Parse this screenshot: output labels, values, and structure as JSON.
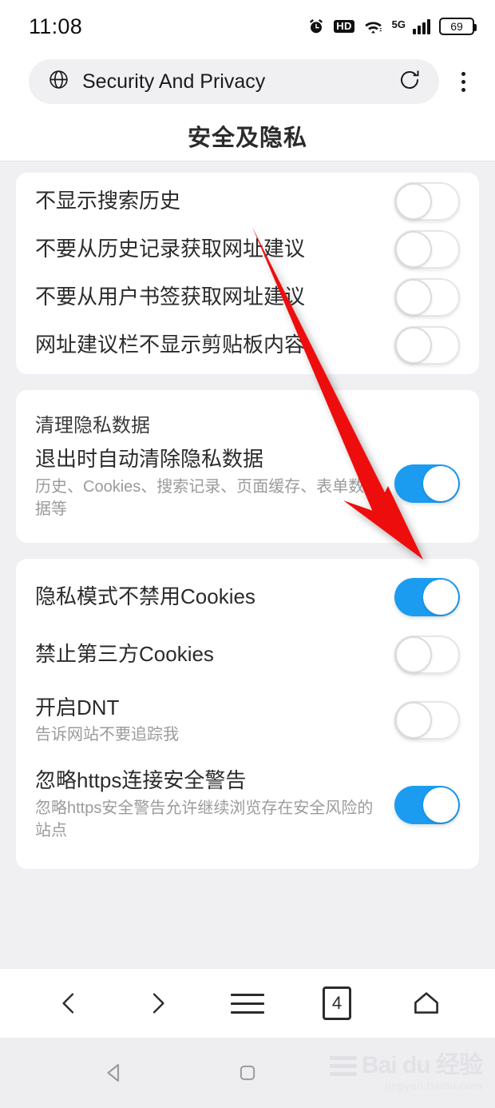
{
  "status_bar": {
    "time": "11:08",
    "alarm_icon": "alarm-clock-icon",
    "hd_label": "HD",
    "wifi_icon": "wifi-icon",
    "network_label": "5G",
    "battery_level": "69"
  },
  "address_bar": {
    "site_icon": "globe-icon",
    "title": "Security And Privacy",
    "reload_icon": "refresh-icon",
    "menu_icon": "more-vertical-icon"
  },
  "page": {
    "title": "安全及隐私"
  },
  "cards": [
    {
      "name": "search-suggestion-card",
      "header": null,
      "rows": [
        {
          "title": "不显示搜索历史",
          "sub": null,
          "state": "off"
        },
        {
          "title": "不要从历史记录获取网址建议",
          "sub": null,
          "state": "off"
        },
        {
          "title": "不要从用户书签获取网址建议",
          "sub": null,
          "state": "off"
        },
        {
          "title": "网址建议栏不显示剪贴板内容",
          "sub": null,
          "state": "off"
        }
      ]
    },
    {
      "name": "clear-private-data-card",
      "header": "清理隐私数据",
      "rows": [
        {
          "title": "退出时自动清除隐私数据",
          "sub": "历史、Cookies、搜索记录、页面缓存、表单数据等",
          "state": "on"
        }
      ]
    },
    {
      "name": "cookies-security-card",
      "header": null,
      "rows": [
        {
          "title": "隐私模式不禁用Cookies",
          "sub": null,
          "state": "on"
        },
        {
          "title": "禁止第三方Cookies",
          "sub": null,
          "state": "off"
        },
        {
          "title": "开启DNT",
          "sub": "告诉网站不要追踪我",
          "state": "off"
        },
        {
          "title": "忽略https连接安全警告",
          "sub": "忽略https安全警告允许继续浏览存在安全风险的站点",
          "state": "on"
        }
      ]
    }
  ],
  "browser_toolbar": {
    "back_icon": "chevron-left-icon",
    "forward_icon": "chevron-right-icon",
    "menu_icon": "hamburger-menu-icon",
    "tab_count": "4",
    "home_icon": "home-icon"
  },
  "android_nav": {
    "back_icon": "triangle-back-icon",
    "home_icon": "square-home-icon"
  },
  "watermark": {
    "brand": "Bai du 经验",
    "url": "jingyan.baidu.com"
  },
  "annotation": {
    "type": "arrow",
    "color": "#ee1111",
    "points_to": "退出时自动清除隐私数据 toggle"
  },
  "colors": {
    "toggle_on": "#1b9cf0",
    "page_background": "#f0f0f2",
    "card_background": "#ffffff",
    "annotation_red": "#ee1111"
  }
}
